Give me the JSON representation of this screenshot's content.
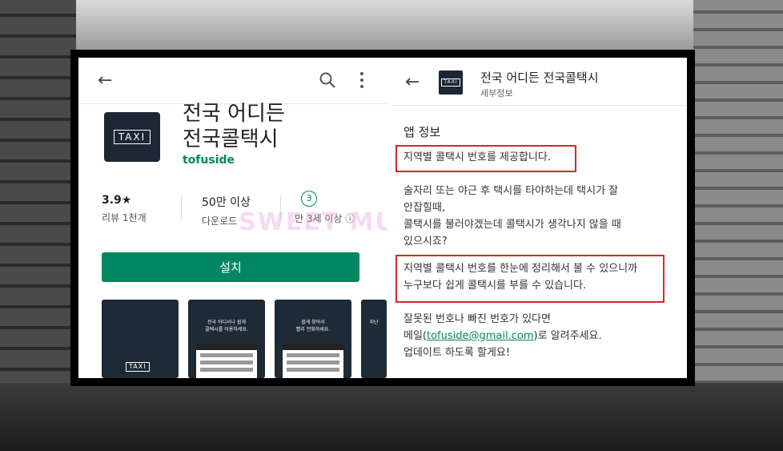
{
  "left": {
    "app_title_line1": "전국 어디든",
    "app_title_line2": "전국콜택시",
    "developer": "tofuside",
    "icon_text": "TAXI",
    "rating": {
      "value": "3.9★",
      "label": "리뷰 1천개"
    },
    "downloads": {
      "value": "50만 이상",
      "label": "다운로드"
    },
    "age": {
      "value": "3",
      "label": "만 3세 이상 ⓘ"
    },
    "install_label": "설치",
    "screenshots": [
      {
        "caption": "",
        "bottom_text": "TAXI"
      },
      {
        "caption": "전국 어디서나 쉽게\n콜택시를 이용하세요."
      },
      {
        "caption": "쉽게 찾아서\n빨리 전화하세요."
      },
      {
        "caption": "지난"
      }
    ]
  },
  "right": {
    "title": "전국 어디든 전국콜택시",
    "subtitle": "세부정보",
    "icon_text": "TAXI",
    "section_title": "앱 정보",
    "line1": "지역별 콜택시 번호를 제공합니다.",
    "para2": [
      "술자리 또는 야근 후 택시를 타야하는데 택시가 잘",
      "안잡힐때,",
      "콜택시를 불러야겠는데 콜택시가 생각나지 않을 때",
      "있으시죠?"
    ],
    "para3": [
      "지역별 콜택시 번호를 한눈에 정리해서 볼 수 있으니까",
      "누구보다 쉽게 콜택시를 부를 수 있습니다."
    ],
    "para4_line1": "잘못된 번호나 빠진 번호가 있다면",
    "para4_mail_prefix": "메일(",
    "para4_email": "tofuside@gmail.com",
    "para4_mail_suffix": ")로 알려주세요.",
    "para4_line3": "업데이트 하도록 할게요!"
  },
  "watermark": "SWEET MUSEUM STORY",
  "colors": {
    "accent_green": "#01875f",
    "highlight_red": "#d12a2a",
    "icon_bg": "#1c2733"
  }
}
